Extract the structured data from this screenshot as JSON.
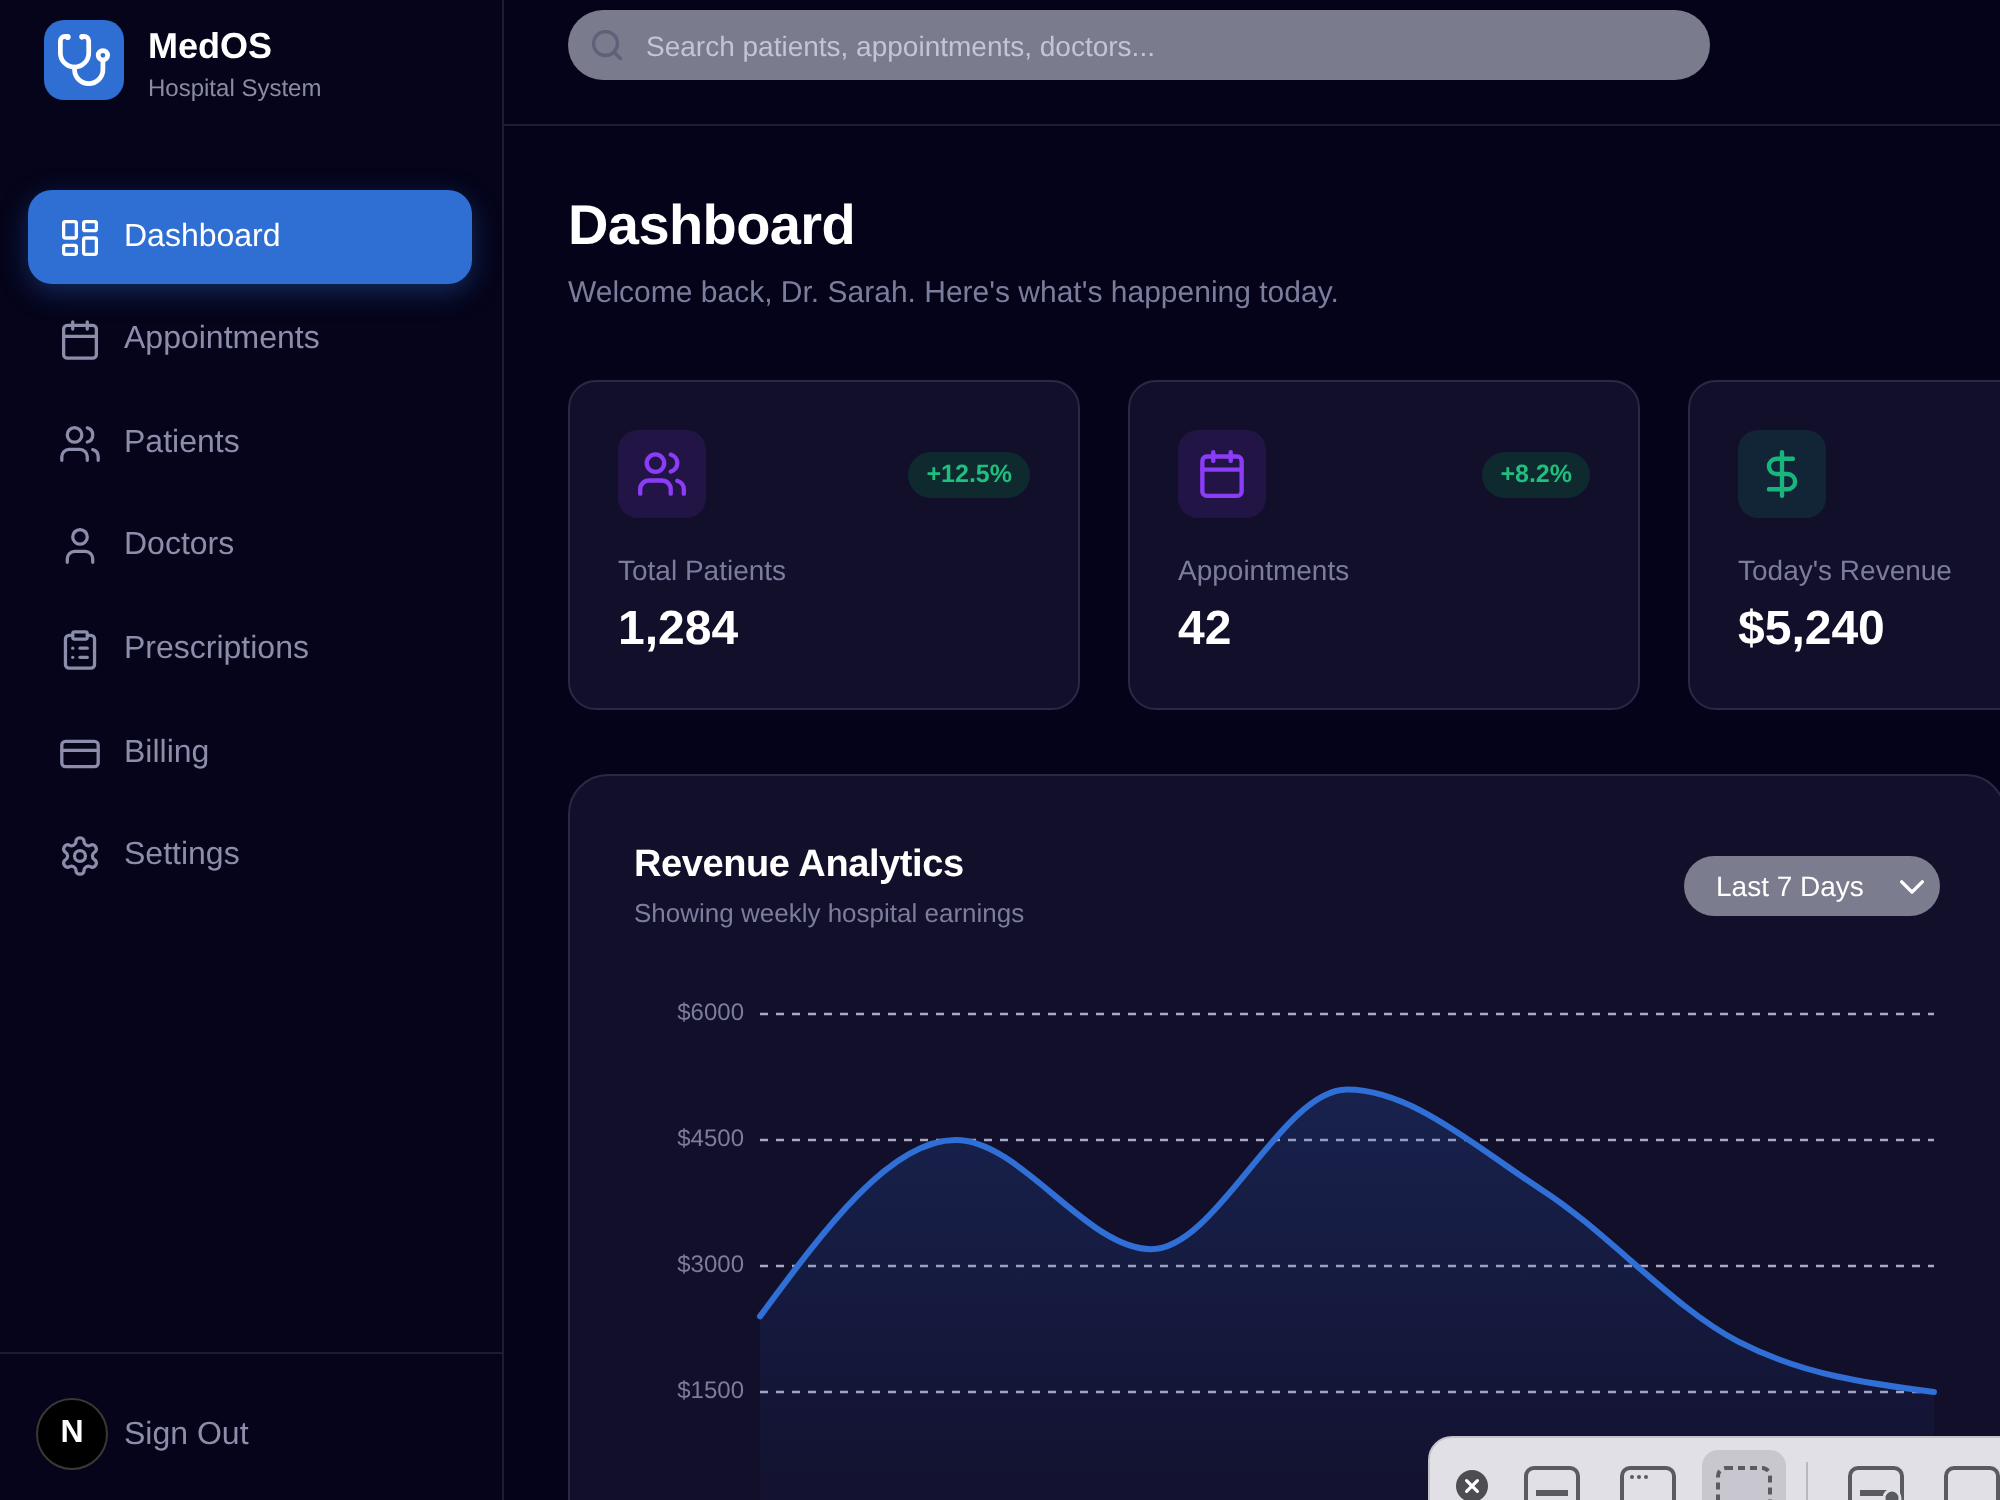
{
  "sidebar": {
    "brand": {
      "name": "MedOS",
      "tagline": "Hospital System"
    },
    "nav": [
      {
        "label": "Dashboard",
        "selected": true
      },
      {
        "label": "Appointments",
        "selected": false
      },
      {
        "label": "Patients",
        "selected": false
      },
      {
        "label": "Doctors",
        "selected": false
      },
      {
        "label": "Prescriptions",
        "selected": false
      },
      {
        "label": "Billing",
        "selected": false
      },
      {
        "label": "Settings",
        "selected": false
      }
    ],
    "sign_out": "Sign Out"
  },
  "dev_indicator": {
    "label": "N"
  },
  "header": {
    "search": {
      "placeholder": "Search patients, appointments, doctors..."
    }
  },
  "page": {
    "title": "Dashboard",
    "subtitle": "Welcome back, Dr. Sarah. Here's what's happening today."
  },
  "stats": [
    {
      "label": "Total Patients",
      "value": "1,284",
      "change": "+12.5%",
      "color": "#8b3cf6"
    },
    {
      "label": "Appointments",
      "value": "42",
      "change": "+8.2%",
      "color": "#8b3cf6"
    },
    {
      "label": "Today's Revenue",
      "value": "$5,240",
      "color": "#19b57c"
    }
  ],
  "revenue": {
    "title": "Revenue Analytics",
    "subtitle": "Showing weekly hospital earnings",
    "range": "Last 7 Days",
    "chart_data": [
      {
        "type": "area",
        "categories": [
          null,
          null,
          null,
          null,
          null,
          null,
          null
        ],
        "values": [
          2400,
          4500,
          3200,
          5100,
          3900,
          2100,
          1500
        ],
        "color": "#2f6fd6",
        "ylim": [
          0,
          6000
        ],
        "yticks": [
          {
            "value": 1500,
            "label": "$1500"
          },
          {
            "value": 3000,
            "label": "$3000"
          },
          {
            "value": 4500,
            "label": "$4500"
          },
          {
            "value": 6000,
            "label": "$6000"
          }
        ],
        "grid": true
      }
    ]
  },
  "capture_toolbar": {
    "capture": [
      {
        "kind": "screen",
        "selected": false
      },
      {
        "kind": "window",
        "selected": false
      },
      {
        "kind": "selection",
        "selected": true
      }
    ],
    "record": [
      {
        "kind": "record-screen",
        "selected": false
      },
      {
        "kind": "record-selection",
        "selected": false
      }
    ]
  }
}
